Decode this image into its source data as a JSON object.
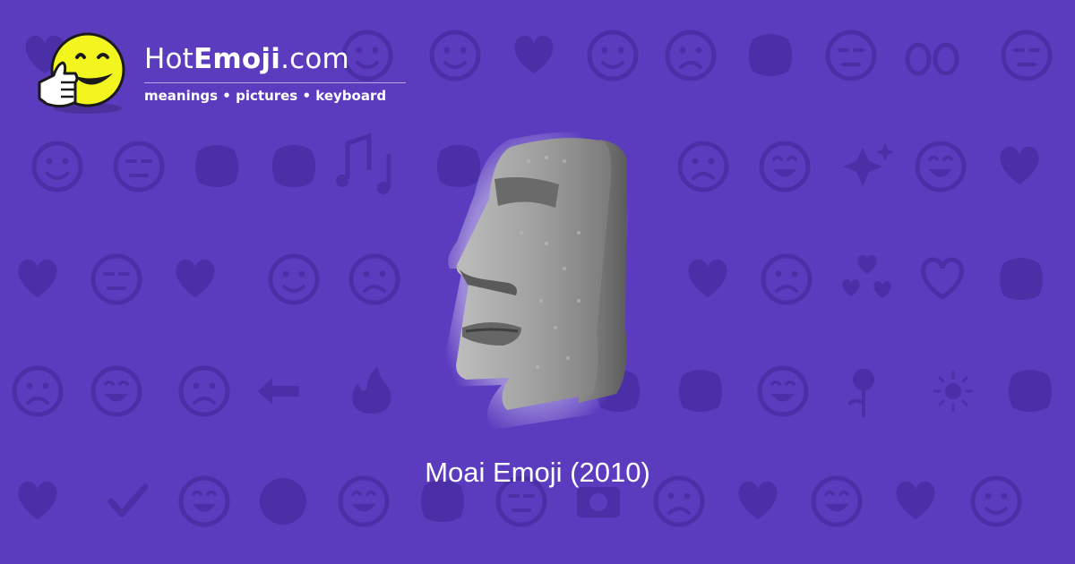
{
  "brand": {
    "title_prefix": "Hot",
    "title_bold": "Emoji",
    "title_suffix": ".com",
    "tagline": "meanings • pictures • keyboard"
  },
  "hero": {
    "icon": "moai-icon",
    "caption": "Moai Emoji (2010)"
  },
  "colors": {
    "background": "#5b3cbf",
    "pattern": "#4a2fa6",
    "logo_face": "#f3f51f",
    "text": "#ffffff"
  },
  "background_icons": [
    "smiling-face-icon",
    "winking-kiss-icon",
    "two-hearts-icon",
    "smiley-icon",
    "weary-face-icon",
    "ok-hand-icon",
    "expressionless-face-icon",
    "eyes-icon",
    "smirk-face-icon",
    "relieved-face-icon",
    "cold-face-icon",
    "recycle-icon",
    "raising-hands-icon",
    "music-notes-icon",
    "see-no-evil-monkey-icon",
    "sleeping-face-icon",
    "sad-face-icon",
    "grinning-face-icon",
    "sparkles-icon",
    "striped-heart-icon",
    "broken-heart-icon",
    "confused-face-icon",
    "tongue-face-icon",
    "frowning-face-icon",
    "heart-arrow-icon",
    "tired-face-icon",
    "revolving-hearts-icon",
    "heart-icon",
    "monkey-icon",
    "scream-face-icon",
    "smiling-devil-icon",
    "angry-face-icon",
    "left-arrow-icon",
    "fire-icon",
    "hand-icon",
    "party-popper-icon",
    "squint-tongue-icon",
    "rose-icon",
    "sun-icon",
    "flexed-biceps-icon",
    "check-mark-icon",
    "laughing-face-icon",
    "dark-face-icon",
    "heart-eyes-cat-icon",
    "waving-hand-icon",
    "medical-mask-icon",
    "camera-icon",
    "persevering-face-icon",
    "kissing-face-icon"
  ]
}
